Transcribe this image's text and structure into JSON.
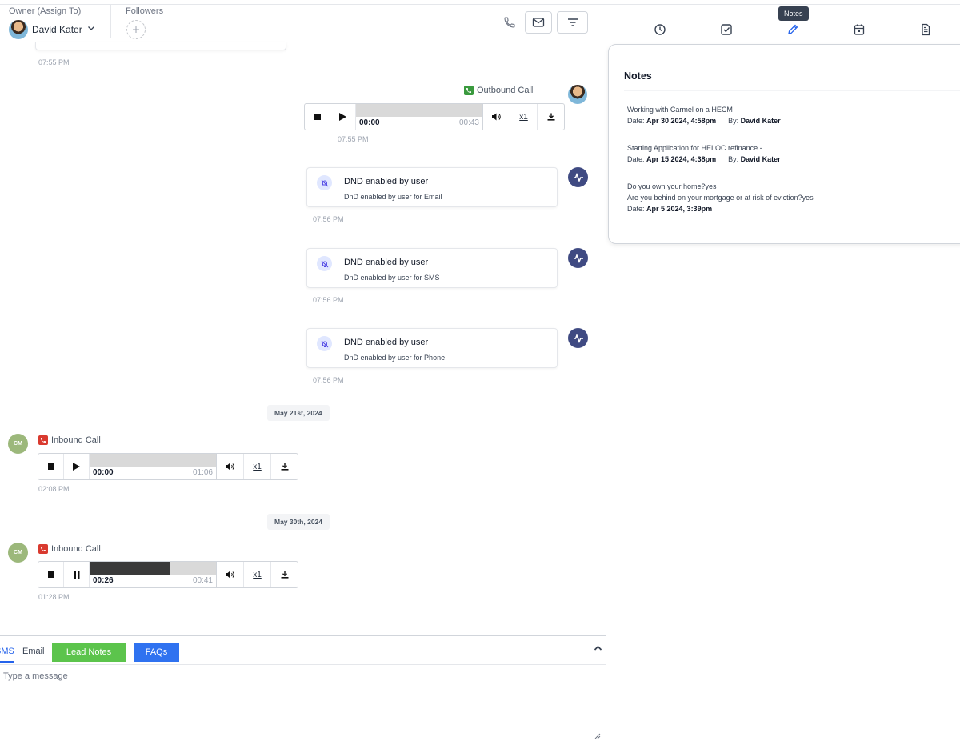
{
  "header": {
    "owner_label": "Owner (Assign To)",
    "owner_name": "David Kater",
    "followers_label": "Followers"
  },
  "right_tabs": {
    "tooltip": "Notes",
    "active": "notes",
    "icons": [
      "history-icon",
      "task-icon",
      "notes-icon",
      "calendar-icon",
      "document-icon"
    ]
  },
  "notes": {
    "title": "Notes",
    "items": [
      {
        "text": "Working with Carmel on a HECM",
        "date_label": "Date:",
        "date": "Apr 30 2024, 4:58pm",
        "by_label": "By:",
        "by": "David Kater"
      },
      {
        "text": "Starting Application for HELOC refinance -",
        "date_label": "Date:",
        "date": "Apr 15 2024, 4:38pm",
        "by_label": "By:",
        "by": "David Kater"
      },
      {
        "text": "Do you own your home?yes",
        "text2": "Are you behind on your mortgage or at risk of eviction?yes",
        "date_label": "Date:",
        "date": "Apr 5 2024, 3:39pm"
      }
    ]
  },
  "conversation": {
    "top_time": "07:55 PM",
    "outbound_call": {
      "label": "Outbound Call",
      "current": "00:00",
      "duration": "00:43",
      "speed": "x1",
      "time": "07:55 PM",
      "progress": 0
    },
    "dnd": [
      {
        "title": "DND enabled by user",
        "subtitle": "DnD enabled by user for Email",
        "time": "07:56 PM"
      },
      {
        "title": "DND enabled by user",
        "subtitle": "DnD enabled by user for SMS",
        "time": "07:56 PM"
      },
      {
        "title": "DND enabled by user",
        "subtitle": "DnD enabled by user for Phone",
        "time": "07:56 PM"
      }
    ],
    "dates": [
      "May 21st, 2024",
      "May 30th, 2024"
    ],
    "inbound_calls": [
      {
        "avatar": "CM",
        "label": "Inbound Call",
        "current": "00:00",
        "duration": "01:06",
        "speed": "x1",
        "time": "02:08 PM",
        "progress": 0,
        "playing": false
      },
      {
        "avatar": "CM",
        "label": "Inbound Call",
        "current": "00:26",
        "duration": "00:41",
        "speed": "x1",
        "time": "01:28 PM",
        "progress": 0.634,
        "playing": true
      }
    ]
  },
  "composer": {
    "tabs": [
      "SMS",
      "Email"
    ],
    "active_tab": "SMS",
    "lead_notes": "Lead Notes",
    "faqs": "FAQs",
    "placeholder": "Type a message"
  },
  "colors": {
    "accent": "#2563eb",
    "activity": "#3f4a82",
    "outbound": "#3a9a3e",
    "inbound": "#d93a2f",
    "green_button": "#5cc44c",
    "blue_button": "#2f72f0"
  }
}
